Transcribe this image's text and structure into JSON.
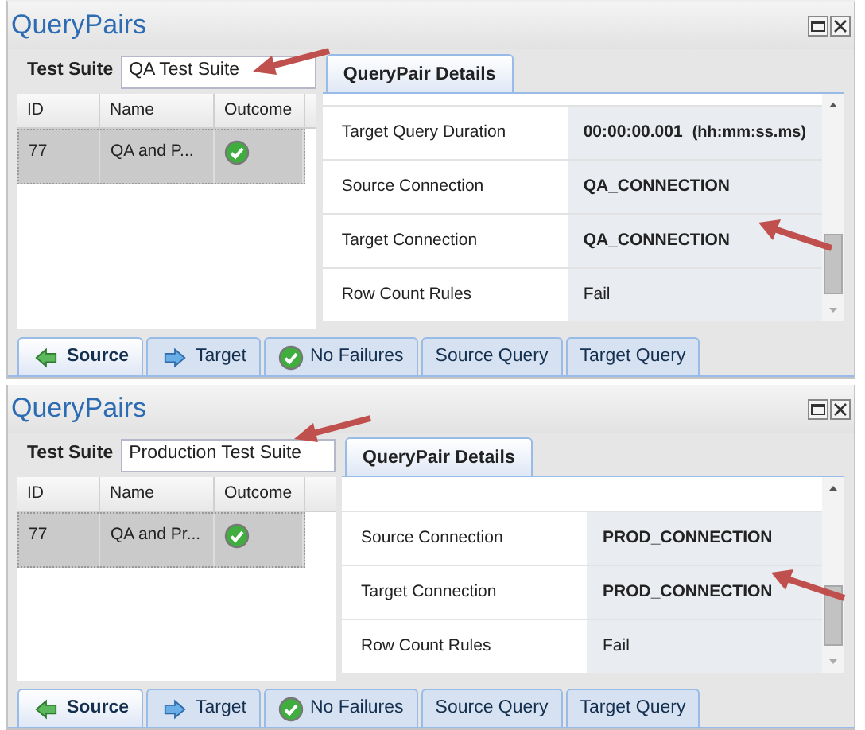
{
  "panels": [
    {
      "title": "QueryPairs",
      "test_suite_label": "Test Suite",
      "test_suite_value": "QA Test Suite",
      "grid": {
        "columns": [
          "ID",
          "Name",
          "Outcome"
        ],
        "rows": [
          {
            "id": "77",
            "name": "QA and P...",
            "selected": true
          }
        ]
      },
      "details_tab": {
        "label": "QueryPair Details",
        "selected": true
      },
      "details": [
        {
          "kind": "strong",
          "label": "Target Query Duration",
          "value": "00:00:00.001",
          "note": "(hh:mm:ss.ms)"
        },
        {
          "kind": "strong",
          "label": "Source Connection",
          "value": "QA_CONNECTION"
        },
        {
          "kind": "strong",
          "label": "Target Connection",
          "value": "QA_CONNECTION"
        },
        {
          "kind": "plain",
          "label": "Row Count Rules",
          "value": "Fail"
        }
      ],
      "bottom_tabs": [
        {
          "kind": "back",
          "label": "Source",
          "selected": true
        },
        {
          "kind": "forward",
          "label": "Target",
          "selected": false
        },
        {
          "kind": "ok",
          "label": "No Failures",
          "selected": false
        },
        {
          "kind": "text",
          "label": "Source Query",
          "selected": false
        },
        {
          "kind": "text",
          "label": "Target Query",
          "selected": false
        }
      ]
    },
    {
      "title": "QueryPairs",
      "test_suite_label": "Test Suite",
      "test_suite_value": "Production Test Suite",
      "grid": {
        "columns": [
          "ID",
          "Name",
          "Outcome"
        ],
        "rows": [
          {
            "id": "77",
            "name": "QA and Pr...",
            "selected": true
          }
        ]
      },
      "details_tab": {
        "label": "QueryPair Details",
        "selected": true
      },
      "details": [
        {
          "kind": "strong",
          "label": "Source Connection",
          "value": "PROD_CONNECTION"
        },
        {
          "kind": "strong",
          "label": "Target Connection",
          "value": "PROD_CONNECTION"
        },
        {
          "kind": "plain",
          "label": "Row Count Rules",
          "value": "Fail"
        }
      ],
      "bottom_tabs": [
        {
          "kind": "back",
          "label": "Source",
          "selected": true
        },
        {
          "kind": "forward",
          "label": "Target",
          "selected": false
        },
        {
          "kind": "ok",
          "label": "No Failures",
          "selected": false
        },
        {
          "kind": "text",
          "label": "Source Query",
          "selected": false
        },
        {
          "kind": "text",
          "label": "Target Query",
          "selected": false
        }
      ]
    }
  ]
}
